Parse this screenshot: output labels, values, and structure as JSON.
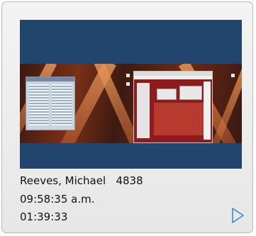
{
  "session": {
    "user_name": "Reeves, Michael",
    "user_id": "4838",
    "start_time": "09:58:35 a.m.",
    "duration": "01:39:33"
  },
  "thumbnail": {
    "background_color": "#21456c"
  },
  "controls": {
    "play_icon": "play-triangle-icon",
    "play_color": "#3d86d6"
  }
}
